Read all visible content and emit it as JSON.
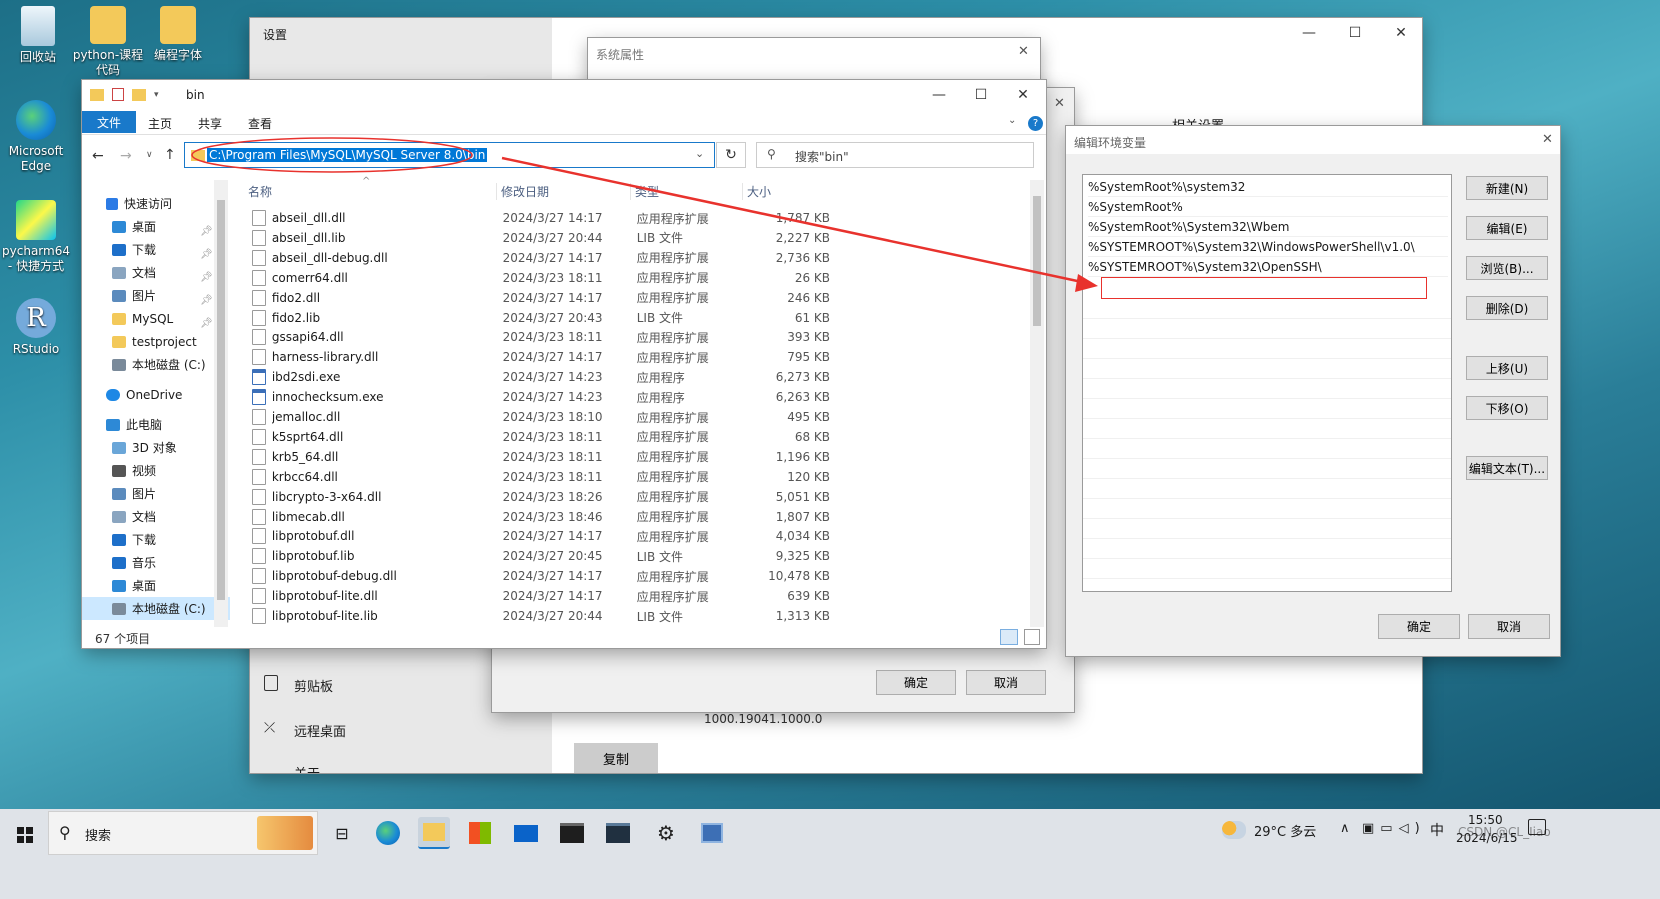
{
  "desktop": {
    "icons": [
      {
        "label": "回收站"
      },
      {
        "label": "python-课程代码"
      },
      {
        "label": "编程字体"
      },
      {
        "label": "Microsoft Edge"
      },
      {
        "label": "pycharm64 - 快捷方式"
      },
      {
        "label": "RStudio"
      }
    ]
  },
  "settings": {
    "title": "设置",
    "related_settings": "相关设置",
    "clipboard": "剪贴板",
    "remote_desktop": "远程桌面",
    "about": "关于",
    "version": "1000.19041.1000.0",
    "copy_button": "复制"
  },
  "sysprops": {
    "title": "系统属性",
    "ok": "确定",
    "cancel": "取消"
  },
  "explorer": {
    "title": "bin",
    "ribbon_tabs": [
      "文件",
      "主页",
      "共享",
      "查看"
    ],
    "address": "C:\\Program Files\\MySQL\\MySQL Server 8.0\\bin",
    "search_placeholder": "搜索\"bin\"",
    "nav": [
      {
        "label": "快速访问",
        "pinned": false
      },
      {
        "label": "桌面",
        "pinned": true
      },
      {
        "label": "下载",
        "pinned": true
      },
      {
        "label": "文档",
        "pinned": true
      },
      {
        "label": "图片",
        "pinned": true
      },
      {
        "label": "MySQL",
        "pinned": true
      },
      {
        "label": "testproject",
        "pinned": false
      },
      {
        "label": "本地磁盘 (C:)",
        "pinned": false
      },
      {
        "label": "OneDrive",
        "pinned": false
      },
      {
        "label": "此电脑",
        "pinned": false
      },
      {
        "label": "3D 对象",
        "pinned": false
      },
      {
        "label": "视频",
        "pinned": false
      },
      {
        "label": "图片",
        "pinned": false
      },
      {
        "label": "文档",
        "pinned": false
      },
      {
        "label": "下载",
        "pinned": false
      },
      {
        "label": "音乐",
        "pinned": false
      },
      {
        "label": "桌面",
        "pinned": false
      },
      {
        "label": "本地磁盘 (C:)",
        "pinned": false
      }
    ],
    "columns": [
      "名称",
      "修改日期",
      "类型",
      "大小"
    ],
    "files": [
      {
        "name": "abseil_dll.dll",
        "date": "2024/3/27 14:17",
        "type": "应用程序扩展",
        "size": "1,787 KB"
      },
      {
        "name": "abseil_dll.lib",
        "date": "2024/3/27 20:44",
        "type": "LIB 文件",
        "size": "2,227 KB"
      },
      {
        "name": "abseil_dll-debug.dll",
        "date": "2024/3/27 14:17",
        "type": "应用程序扩展",
        "size": "2,736 KB"
      },
      {
        "name": "comerr64.dll",
        "date": "2024/3/23 18:11",
        "type": "应用程序扩展",
        "size": "26 KB"
      },
      {
        "name": "fido2.dll",
        "date": "2024/3/27 14:17",
        "type": "应用程序扩展",
        "size": "246 KB"
      },
      {
        "name": "fido2.lib",
        "date": "2024/3/27 20:43",
        "type": "LIB 文件",
        "size": "61 KB"
      },
      {
        "name": "gssapi64.dll",
        "date": "2024/3/23 18:11",
        "type": "应用程序扩展",
        "size": "393 KB"
      },
      {
        "name": "harness-library.dll",
        "date": "2024/3/27 14:17",
        "type": "应用程序扩展",
        "size": "795 KB"
      },
      {
        "name": "ibd2sdi.exe",
        "date": "2024/3/27 14:23",
        "type": "应用程序",
        "size": "6,273 KB"
      },
      {
        "name": "innochecksum.exe",
        "date": "2024/3/27 14:23",
        "type": "应用程序",
        "size": "6,263 KB"
      },
      {
        "name": "jemalloc.dll",
        "date": "2024/3/23 18:10",
        "type": "应用程序扩展",
        "size": "495 KB"
      },
      {
        "name": "k5sprt64.dll",
        "date": "2024/3/23 18:11",
        "type": "应用程序扩展",
        "size": "68 KB"
      },
      {
        "name": "krb5_64.dll",
        "date": "2024/3/23 18:11",
        "type": "应用程序扩展",
        "size": "1,196 KB"
      },
      {
        "name": "krbcc64.dll",
        "date": "2024/3/23 18:11",
        "type": "应用程序扩展",
        "size": "120 KB"
      },
      {
        "name": "libcrypto-3-x64.dll",
        "date": "2024/3/23 18:26",
        "type": "应用程序扩展",
        "size": "5,051 KB"
      },
      {
        "name": "libmecab.dll",
        "date": "2024/3/23 18:46",
        "type": "应用程序扩展",
        "size": "1,807 KB"
      },
      {
        "name": "libprotobuf.dll",
        "date": "2024/3/27 14:17",
        "type": "应用程序扩展",
        "size": "4,034 KB"
      },
      {
        "name": "libprotobuf.lib",
        "date": "2024/3/27 20:45",
        "type": "LIB 文件",
        "size": "9,325 KB"
      },
      {
        "name": "libprotobuf-debug.dll",
        "date": "2024/3/27 14:17",
        "type": "应用程序扩展",
        "size": "10,478 KB"
      },
      {
        "name": "libprotobuf-lite.dll",
        "date": "2024/3/27 14:17",
        "type": "应用程序扩展",
        "size": "639 KB"
      },
      {
        "name": "libprotobuf-lite.lib",
        "date": "2024/3/27 20:44",
        "type": "LIB 文件",
        "size": "1,313 KB"
      }
    ],
    "status": "67 个项目"
  },
  "env_dialog": {
    "title": "编辑环境变量",
    "entries": [
      "%SystemRoot%\\system32",
      "%SystemRoot%",
      "%SystemRoot%\\System32\\Wbem",
      "%SYSTEMROOT%\\System32\\WindowsPowerShell\\v1.0\\",
      "%SYSTEMROOT%\\System32\\OpenSSH\\"
    ],
    "buttons": {
      "new": "新建(N)",
      "edit": "编辑(E)",
      "browse": "浏览(B)...",
      "delete": "删除(D)",
      "up": "上移(U)",
      "down": "下移(O)",
      "edit_text": "编辑文本(T)...",
      "ok": "确定",
      "cancel": "取消"
    }
  },
  "taskbar": {
    "search": "搜索",
    "weather": "29°C 多云",
    "ime": "中",
    "time": "15:50",
    "date": "2024/6/15",
    "watermark": "CSDN @CL_Iiao"
  },
  "colors": {
    "accent": "#1979ca",
    "annotation_red": "#e8322d",
    "selection": "#0078d7"
  }
}
